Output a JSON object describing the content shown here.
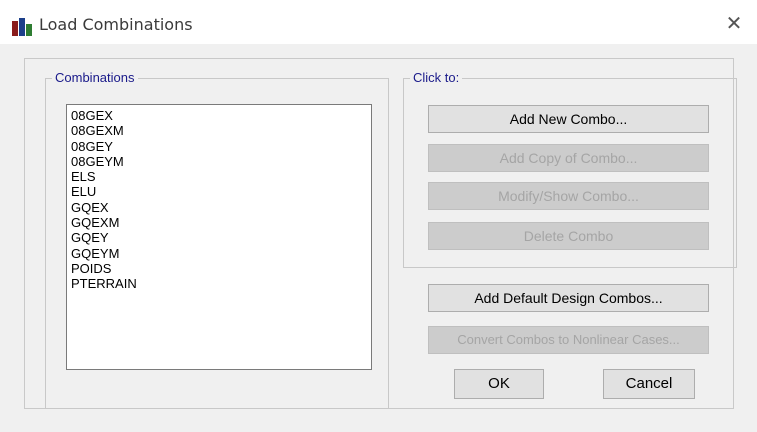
{
  "window": {
    "title": "Load Combinations",
    "icon": "app-load-combo-icon",
    "close_glyph": "✕"
  },
  "combinations_group": {
    "label": "Combinations",
    "items": [
      "08GEX",
      "08GEXM",
      "08GEY",
      "08GEYM",
      "ELS",
      "ELU",
      "GQEX",
      "GQEXM",
      "GQEY",
      "GQEYM",
      "POIDS",
      "PTERRAIN"
    ]
  },
  "click_group": {
    "label": "Click to:",
    "add_new": "Add New Combo...",
    "add_copy": "Add Copy of Combo...",
    "modify_show": "Modify/Show Combo...",
    "delete": "Delete Combo"
  },
  "buttons": {
    "add_default": "Add Default Design Combos...",
    "convert": "Convert Combos to Nonlinear Cases...",
    "ok": "OK",
    "cancel": "Cancel"
  }
}
